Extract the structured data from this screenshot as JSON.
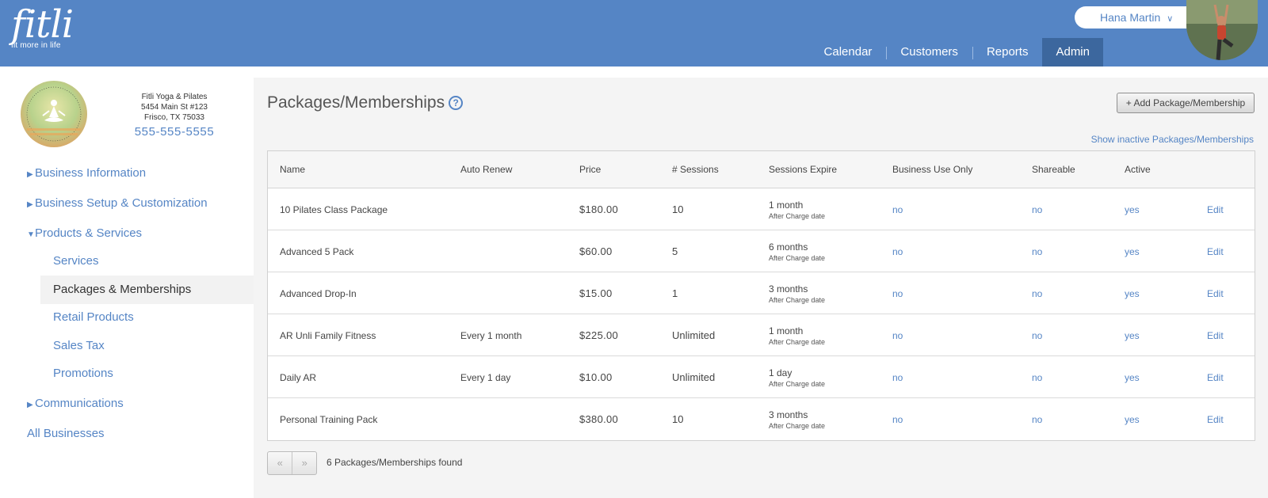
{
  "header": {
    "logo_word": "fitli",
    "logo_tagline": "fit more in life",
    "user_name": "Hana Martin",
    "nav": [
      {
        "label": "Calendar",
        "active": false
      },
      {
        "label": "Customers",
        "active": false
      },
      {
        "label": "Reports",
        "active": false
      },
      {
        "label": "Admin",
        "active": true
      }
    ]
  },
  "sidebar": {
    "business": {
      "name": "Fitli Yoga & Pilates",
      "address1": "5454 Main St #123",
      "address2": "Frisco, TX 75033",
      "phone": "555-555-5555"
    },
    "menu": {
      "business_information": "Business Information",
      "business_setup": "Business Setup & Customization",
      "products_services": "Products & Services",
      "services": "Services",
      "packages_memberships": "Packages & Memberships",
      "retail_products": "Retail Products",
      "sales_tax": "Sales Tax",
      "promotions": "Promotions",
      "communications": "Communications",
      "all_businesses": "All Businesses"
    }
  },
  "main": {
    "title": "Packages/Memberships",
    "help_icon": "question-circle-icon",
    "add_button": "+ Add Package/Membership",
    "show_inactive": "Show inactive Packages/Memberships",
    "columns": {
      "name": "Name",
      "auto_renew": "Auto Renew",
      "price": "Price",
      "sessions": "# Sessions",
      "sessions_expire": "Sessions Expire",
      "business_use_only": "Business Use Only",
      "shareable": "Shareable",
      "active": "Active"
    },
    "rows": [
      {
        "name": "10 Pilates Class Package",
        "auto_renew": "",
        "price": "$180.00",
        "sessions": "10",
        "expire": "1 month",
        "expire_sub": "After Charge date",
        "business_use_only": "no",
        "shareable": "no",
        "active": "yes",
        "edit": "Edit"
      },
      {
        "name": "Advanced 5 Pack",
        "auto_renew": "",
        "price": "$60.00",
        "sessions": "5",
        "expire": "6 months",
        "expire_sub": "After Charge date",
        "business_use_only": "no",
        "shareable": "no",
        "active": "yes",
        "edit": "Edit"
      },
      {
        "name": "Advanced Drop-In",
        "auto_renew": "",
        "price": "$15.00",
        "sessions": "1",
        "expire": "3 months",
        "expire_sub": "After Charge date",
        "business_use_only": "no",
        "shareable": "no",
        "active": "yes",
        "edit": "Edit"
      },
      {
        "name": "AR Unli Family Fitness",
        "auto_renew": "Every 1 month",
        "price": "$225.00",
        "sessions": "Unlimited",
        "expire": "1 month",
        "expire_sub": "After Charge date",
        "business_use_only": "no",
        "shareable": "no",
        "active": "yes",
        "edit": "Edit"
      },
      {
        "name": "Daily AR",
        "auto_renew": "Every 1 day",
        "price": "$10.00",
        "sessions": "Unlimited",
        "expire": "1 day",
        "expire_sub": "After Charge date",
        "business_use_only": "no",
        "shareable": "no",
        "active": "yes",
        "edit": "Edit"
      },
      {
        "name": "Personal Training Pack",
        "auto_renew": "",
        "price": "$380.00",
        "sessions": "10",
        "expire": "3 months",
        "expire_sub": "After Charge date",
        "business_use_only": "no",
        "shareable": "no",
        "active": "yes",
        "edit": "Edit"
      }
    ],
    "pager": {
      "prev": "«",
      "next": "»"
    },
    "found_text": "6 Packages/Memberships found"
  },
  "colors": {
    "header_blue": "#5585c5",
    "nav_active": "#3c679e",
    "link_blue": "#5585c5"
  }
}
